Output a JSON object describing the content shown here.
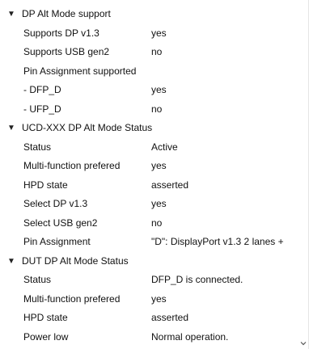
{
  "groups": [
    {
      "title": "DP Alt Mode support",
      "rows": [
        {
          "key": "Supports DP v1.3",
          "value": "yes"
        },
        {
          "key": "Supports USB gen2",
          "value": "no"
        },
        {
          "key": "Pin Assignment supported",
          "value": ""
        },
        {
          "key": "- DFP_D",
          "value": "yes"
        },
        {
          "key": "- UFP_D",
          "value": "no"
        }
      ]
    },
    {
      "title": "UCD-XXX DP Alt Mode Status",
      "rows": [
        {
          "key": "Status",
          "value": "Active"
        },
        {
          "key": "Multi-function prefered",
          "value": "yes"
        },
        {
          "key": "HPD state",
          "value": "asserted"
        },
        {
          "key": "Select DP v1.3",
          "value": "yes"
        },
        {
          "key": "Select USB gen2",
          "value": "no"
        },
        {
          "key": "Pin Assignment",
          "value": "\"D\": DisplayPort v1.3 2 lanes +"
        }
      ]
    },
    {
      "title": "DUT DP Alt Mode Status",
      "rows": [
        {
          "key": "Status",
          "value": "DFP_D is connected."
        },
        {
          "key": "Multi-function prefered",
          "value": "yes"
        },
        {
          "key": "HPD state",
          "value": "asserted"
        },
        {
          "key": "Power low",
          "value": "Normal operation."
        }
      ]
    }
  ],
  "icons": {
    "expanded_arrow": "triangle-down-icon",
    "scroll_down": "chevron-down-icon"
  },
  "colors": {
    "text": "#111111",
    "background": "#ffffff"
  }
}
